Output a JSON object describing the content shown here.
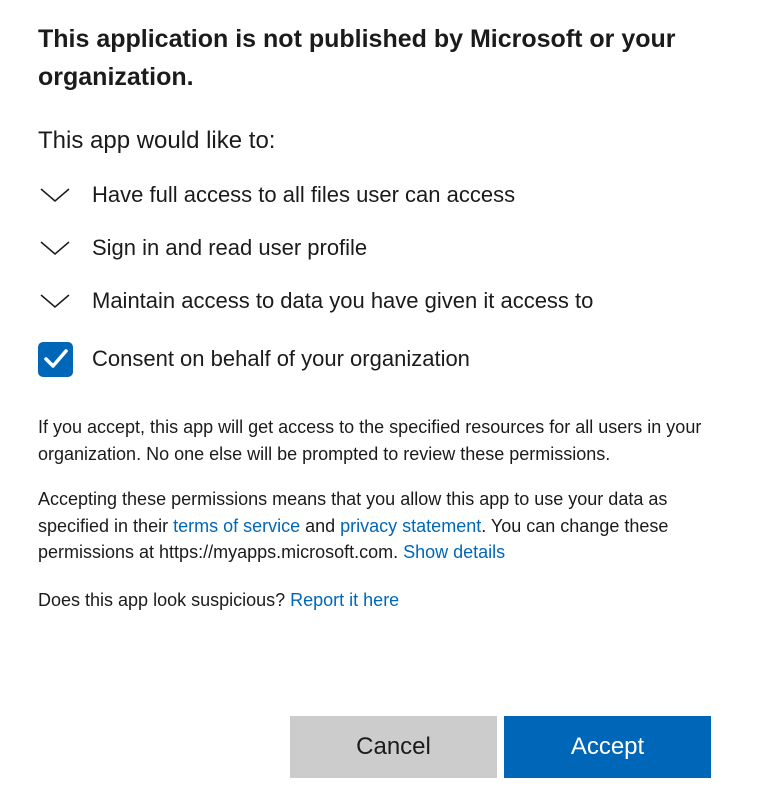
{
  "dialog": {
    "title": "This application is not published by Microsoft or your organization.",
    "subtitle": "This app would like to:",
    "permissions": [
      {
        "label": "Have full access to all files user can access"
      },
      {
        "label": "Sign in and read user profile"
      },
      {
        "label": "Maintain access to data you have given it access to"
      }
    ],
    "consent": {
      "label": "Consent on behalf of your organization",
      "checked": true
    },
    "paragraph1": "If you accept, this app will get access to the specified resources for all users in your organization. No one else will be prompted to review these permissions.",
    "paragraph2": {
      "text_a": "Accepting these permissions means that you allow this app to use your data as specified in their ",
      "terms_link": "terms of service",
      "text_b": " and ",
      "privacy_link": "privacy statement",
      "text_c": ". You can change these permissions at https://myapps.microsoft.com. ",
      "details_link": "Show details"
    },
    "paragraph3": {
      "text": "Does this app look suspicious? ",
      "report_link": "Report it here"
    },
    "buttons": {
      "cancel": "Cancel",
      "accept": "Accept"
    }
  },
  "colors": {
    "accent": "#0067b8",
    "cancel_bg": "#cccccc",
    "text": "#1b1b1b"
  }
}
